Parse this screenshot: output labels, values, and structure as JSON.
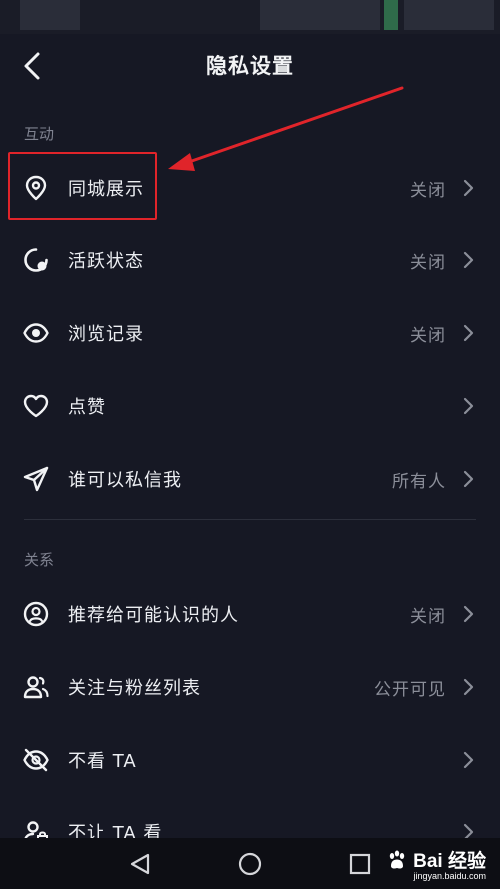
{
  "header": {
    "title": "隐私设置"
  },
  "sections": [
    {
      "label": "互动"
    },
    {
      "label": "关系"
    }
  ],
  "rows": [
    {
      "label": "同城展示",
      "value": "关闭",
      "icon": "location-pin-icon"
    },
    {
      "label": "活跃状态",
      "value": "关闭",
      "icon": "activity-status-icon"
    },
    {
      "label": "浏览记录",
      "value": "关闭",
      "icon": "eye-icon"
    },
    {
      "label": "点赞",
      "value": "",
      "icon": "heart-icon"
    },
    {
      "label": "谁可以私信我",
      "value": "所有人",
      "icon": "paper-plane-icon"
    },
    {
      "label": "推荐给可能认识的人",
      "value": "关闭",
      "icon": "user-circle-icon"
    },
    {
      "label": "关注与粉丝列表",
      "value": "公开可见",
      "icon": "users-icon"
    },
    {
      "label": "不看 TA",
      "value": "",
      "icon": "eye-off-icon"
    },
    {
      "label": "不让 TA 看",
      "value": "",
      "icon": "user-lock-icon"
    }
  ],
  "watermark": {
    "brand": "Bai 经验",
    "url": "jingyan.baidu.com"
  },
  "colors": {
    "background": "#161824",
    "highlight": "#e0242a",
    "value_text": "#8b8e99"
  }
}
